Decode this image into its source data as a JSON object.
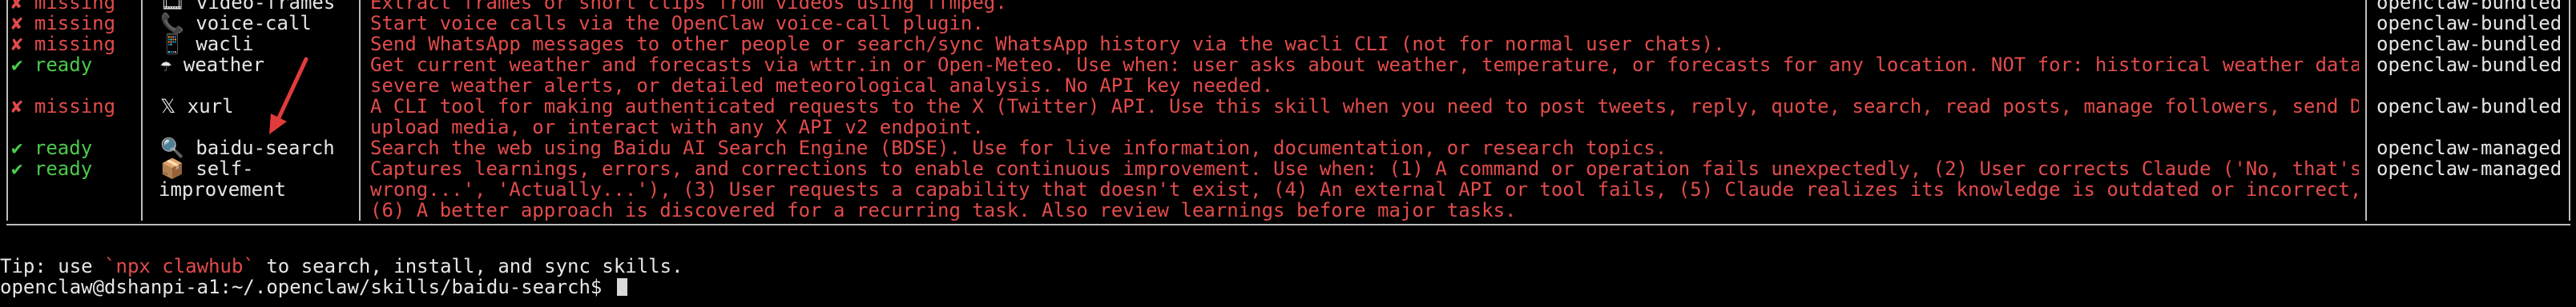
{
  "table": {
    "rows": [
      {
        "status_icon": "✘",
        "status": "missing",
        "ok": false,
        "icon": "🎞",
        "skill": "video-frames",
        "desc": [
          "Extract frames or short clips from videos using ffmpeg."
        ],
        "source": "openclaw-bundled"
      },
      {
        "status_icon": "✘",
        "status": "missing",
        "ok": false,
        "icon": "📞",
        "skill": "voice-call",
        "desc": [
          "Start voice calls via the OpenClaw voice-call plugin."
        ],
        "source": "openclaw-bundled"
      },
      {
        "status_icon": "✘",
        "status": "missing",
        "ok": false,
        "icon": "📱",
        "skill": "wacli",
        "desc": [
          "Send WhatsApp messages to other people or search/sync WhatsApp history via the wacli CLI (not for normal user chats)."
        ],
        "source": "openclaw-bundled"
      },
      {
        "status_icon": "✔",
        "status": "ready",
        "ok": true,
        "icon": "☂",
        "skill": "weather",
        "desc": [
          "Get current weather and forecasts via wttr.in or Open-Meteo. Use when: user asks about weather, temperature, or forecasts for any location. NOT for: historical weather data,",
          "severe weather alerts, or detailed meteorological analysis. No API key needed."
        ],
        "source": "openclaw-bundled"
      },
      {
        "status_icon": "✘",
        "status": "missing",
        "ok": false,
        "icon": "𝕏",
        "skill": "xurl",
        "desc": [
          "A CLI tool for making authenticated requests to the X (Twitter) API. Use this skill when you need to post tweets, reply, quote, search, read posts, manage followers, send DMs,",
          "upload media, or interact with any X API v2 endpoint."
        ],
        "source": "openclaw-bundled"
      },
      {
        "status_icon": "✔",
        "status": "ready",
        "ok": true,
        "icon": "🔍",
        "skill": "baidu-search",
        "desc": [
          "Search the web using Baidu AI Search Engine (BDSE). Use for live information, documentation, or research topics."
        ],
        "source": "openclaw-managed"
      },
      {
        "status_icon": "✔",
        "status": "ready",
        "ok": true,
        "icon": "📦",
        "skill": "self-",
        "skill2": "improvement",
        "desc": [
          "Captures learnings, errors, and corrections to enable continuous improvement. Use when: (1) A command or operation fails unexpectedly, (2) User corrects Claude ('No, that's",
          "wrong...', 'Actually...'), (3) User requests a capability that doesn't exist, (4) An external API or tool fails, (5) Claude realizes its knowledge is outdated or incorrect,",
          "(6) A better approach is discovered for a recurring task. Also review learnings before major tasks."
        ],
        "source": "openclaw-managed"
      }
    ]
  },
  "tip": {
    "prefix": "Tip: use ",
    "code": "`npx clawhub`",
    "suffix": " to search, install, and sync skills."
  },
  "prompt": {
    "text": "openclaw@dshanpi-a1:~/.openclaw/skills/baidu-search$ "
  },
  "colors": {
    "ready": "#4cc94c",
    "missing": "#e24b4b",
    "description": "#e24b4b",
    "border": "#bdbdbd",
    "background": "#000000"
  }
}
